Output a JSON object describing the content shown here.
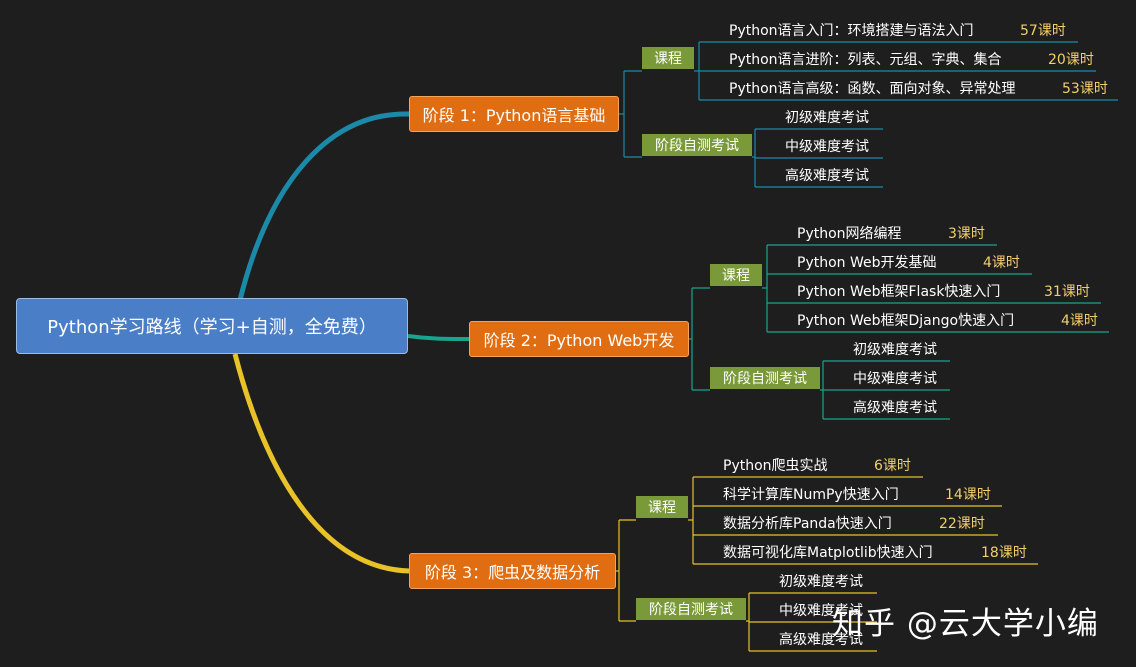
{
  "root": "Python学习路线（学习+自测，全免费）",
  "colors": {
    "stage1": "#1b8aa8",
    "stage2": "#1aa38f",
    "stage3": "#e8c227"
  },
  "stages": [
    {
      "title": "阶段 1：Python语言基础",
      "course_label": "课程",
      "exam_label": "阶段自测考试",
      "courses": [
        {
          "name": "Python语言入门：环境搭建与语法入门",
          "hours": "57课时"
        },
        {
          "name": "Python语言进阶：列表、元组、字典、集合",
          "hours": "20课时"
        },
        {
          "name": "Python语言高级：函数、面向对象、异常处理",
          "hours": "53课时"
        }
      ],
      "exams": [
        "初级难度考试",
        "中级难度考试",
        "高级难度考试"
      ]
    },
    {
      "title": "阶段 2：Python Web开发",
      "course_label": "课程",
      "exam_label": "阶段自测考试",
      "courses": [
        {
          "name": "Python网络编程",
          "hours": "3课时"
        },
        {
          "name": "Python Web开发基础",
          "hours": "4课时"
        },
        {
          "name": "Python Web框架Flask快速入门",
          "hours": "31课时"
        },
        {
          "name": "Python Web框架Django快速入门",
          "hours": "4课时"
        }
      ],
      "exams": [
        "初级难度考试",
        "中级难度考试",
        "高级难度考试"
      ]
    },
    {
      "title": "阶段 3：爬虫及数据分析",
      "course_label": "课程",
      "exam_label": "阶段自测考试",
      "courses": [
        {
          "name": "Python爬虫实战",
          "hours": "6课时"
        },
        {
          "name": "科学计算库NumPy快速入门",
          "hours": "14课时"
        },
        {
          "name": "数据分析库Panda快速入门",
          "hours": "22课时"
        },
        {
          "name": "数据可视化库Matplotlib快速入门",
          "hours": "18课时"
        }
      ],
      "exams": [
        "初级难度考试",
        "中级难度考试",
        "高级难度考试"
      ]
    }
  ],
  "watermark": "知乎 @云大学小编"
}
